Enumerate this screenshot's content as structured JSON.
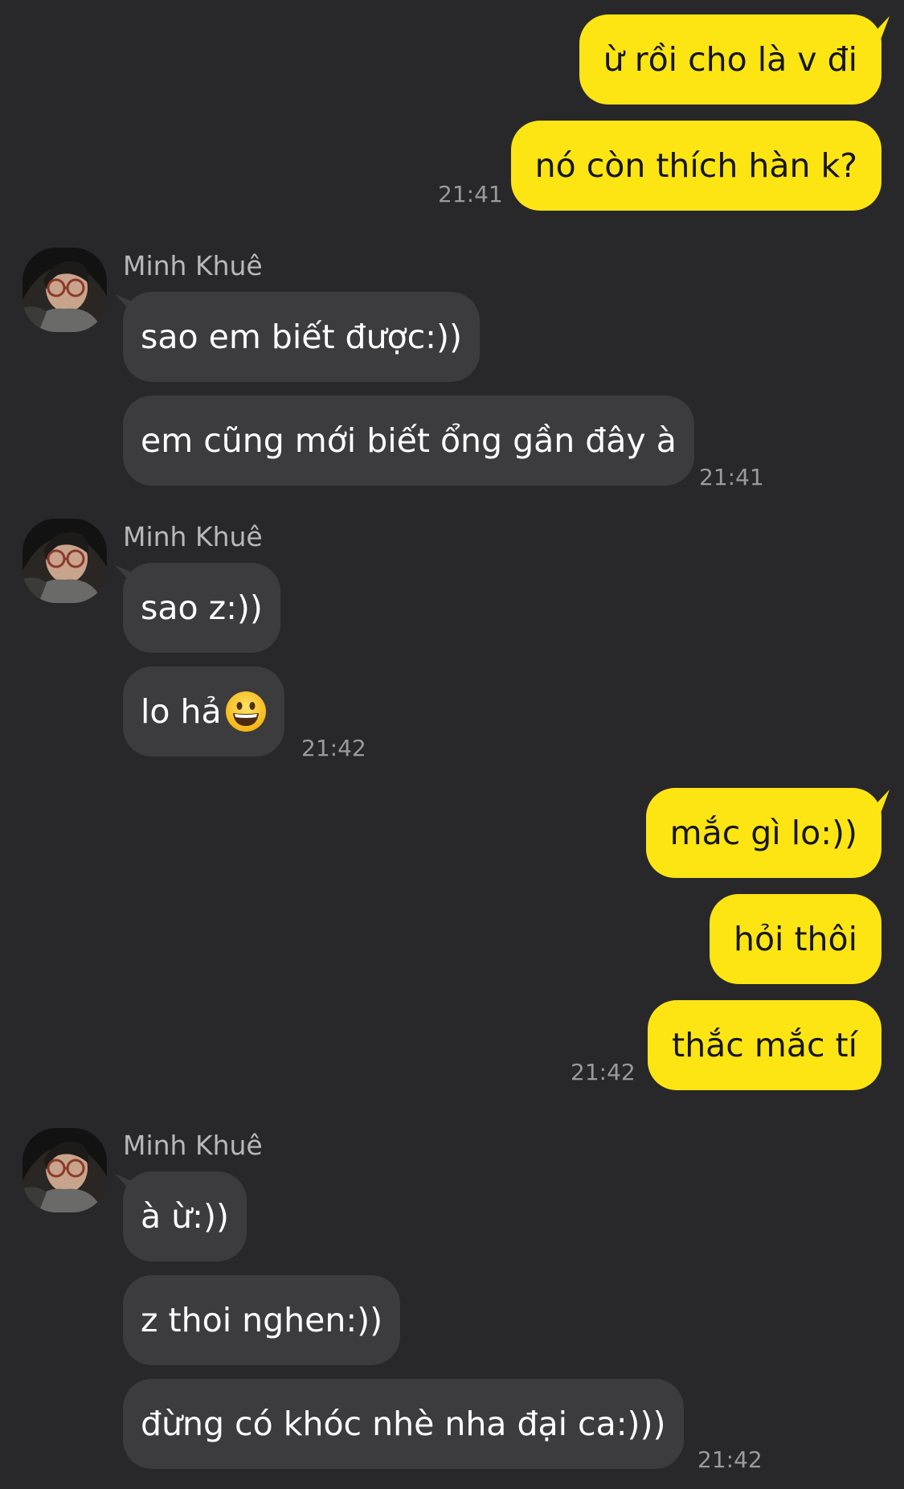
{
  "contact": {
    "name": "Minh Khuê"
  },
  "messages": {
    "m1": "ừ rồi cho là v đi",
    "m2": "nó còn thích hàn k?",
    "t1": "21:41",
    "m3": "sao em biết được:))",
    "m4": "em cũng mới biết ổng gần đây à",
    "t2": "21:41",
    "m5": "sao z:))",
    "m6": "lo hả",
    "t3": "21:42",
    "m7": "mắc gì lo:))",
    "m8": "hỏi thôi",
    "m9": "thắc mắc tí",
    "t4": "21:42",
    "m10": "à ừ:))",
    "m11": "z thoi nghen:))",
    "m12": "đừng có khóc nhè nha đại ca:)))",
    "t5": "21:42"
  },
  "icons": {
    "emoji": "grinning-face-icon"
  },
  "colors": {
    "background": "#28282a",
    "outgoing_bubble": "#fde514",
    "incoming_bubble": "#3c3c3e",
    "timestamp": "#9a9a9e"
  }
}
